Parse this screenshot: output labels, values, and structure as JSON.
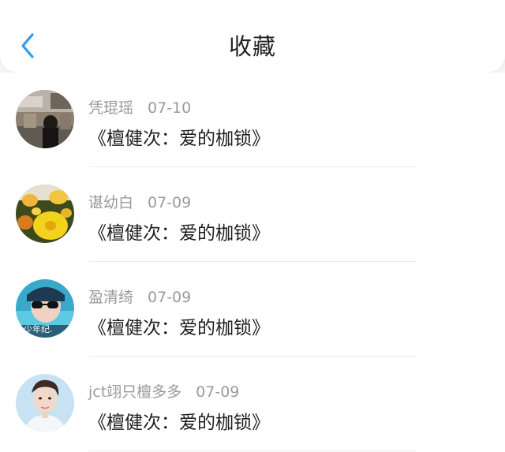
{
  "header": {
    "title": "收藏",
    "back_icon": "chevron-left-icon",
    "accent": "#2f9bf0"
  },
  "items": [
    {
      "user": "凭琨瑶",
      "date": "07-10",
      "work": "《檀健次：爱的枷锁》",
      "avatar": "street-photo-avatar"
    },
    {
      "user": "谌幼白",
      "date": "07-09",
      "work": "《檀健次：爱的枷锁》",
      "avatar": "yellow-flowers-avatar"
    },
    {
      "user": "盈清绮",
      "date": "07-09",
      "work": "《檀健次：爱的枷锁》",
      "avatar": "sunglasses-portrait-avatar",
      "avatar_text": "少年纪."
    },
    {
      "user": "jct翊只檀多多",
      "date": "07-09",
      "work": "《檀健次：爱的枷锁》",
      "avatar": "man-portrait-avatar"
    }
  ]
}
